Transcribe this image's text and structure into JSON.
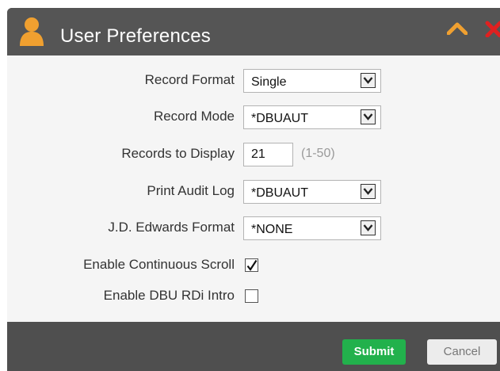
{
  "dialog": {
    "title": "User Preferences",
    "icons": {
      "user": "user-icon",
      "collapse": "chevron-up-icon",
      "close": "close-icon"
    },
    "colors": {
      "titlebar": "#555555",
      "icon_orange": "#f0a030",
      "close_red": "#e02020",
      "submit_green": "#22b14c"
    }
  },
  "form": {
    "record_format": {
      "label": "Record Format",
      "value": "Single"
    },
    "record_mode": {
      "label": "Record Mode",
      "value": "*DBUAUT"
    },
    "records_to_display": {
      "label": "Records to Display",
      "value": "21",
      "hint": "(1-50)"
    },
    "print_audit_log": {
      "label": "Print Audit Log",
      "value": "*DBUAUT"
    },
    "jde_format": {
      "label": "J.D. Edwards Format",
      "value": "*NONE"
    },
    "continuous_scroll": {
      "label": "Enable Continuous Scroll",
      "checked": true
    },
    "rdi_intro": {
      "label": "Enable DBU RDi Intro",
      "checked": false
    }
  },
  "footer": {
    "submit_label": "Submit",
    "cancel_label": "Cancel"
  }
}
